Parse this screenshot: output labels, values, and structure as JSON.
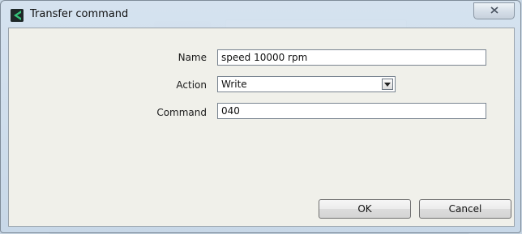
{
  "window": {
    "title": "Transfer command",
    "icon": "app-logo-icon",
    "close_icon": "close-x-icon"
  },
  "form": {
    "name_label": "Name",
    "name_value": "speed 10000 rpm",
    "action_label": "Action",
    "action_value": "Write",
    "command_label": "Command",
    "command_value": "040"
  },
  "buttons": {
    "ok_label": "OK",
    "cancel_label": "Cancel"
  },
  "colors": {
    "titlebar": "#d6e3f0",
    "panel": "#f0f0ea",
    "icon_accent": "#2fae6b"
  }
}
